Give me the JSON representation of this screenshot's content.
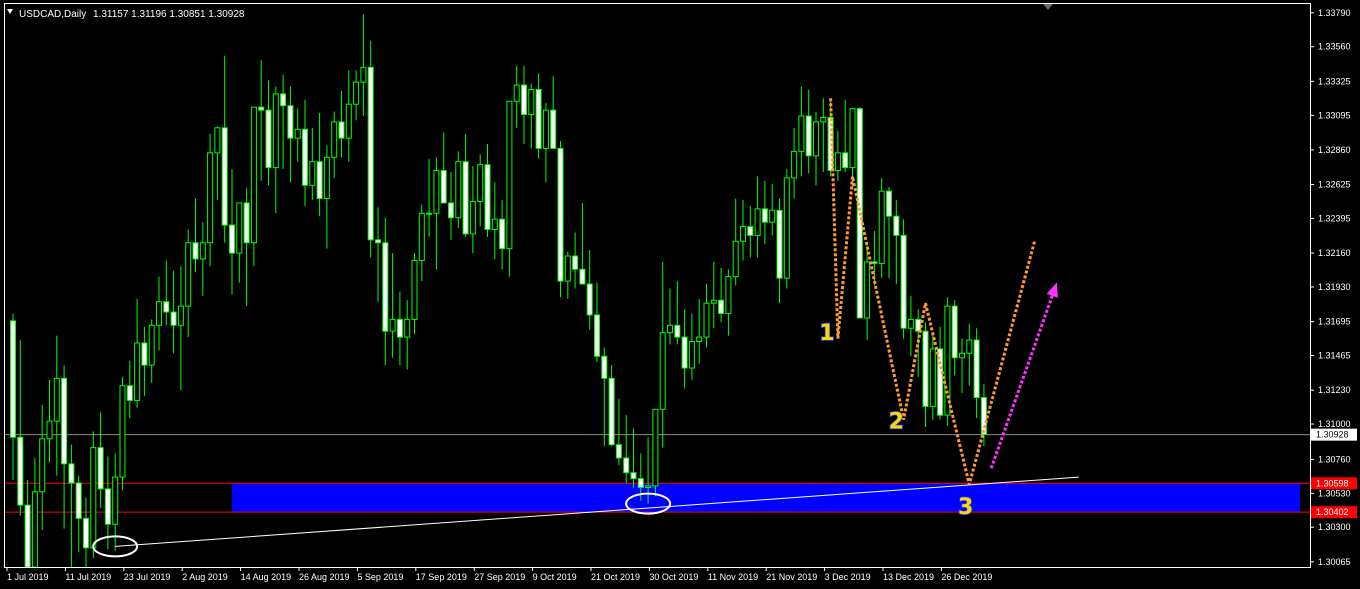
{
  "header": {
    "symbol": "USDCAD,Daily",
    "ohlc": "1.31157 1.31196 1.30851 1.30928"
  },
  "colors": {
    "background": "#000000",
    "candle": "#00ff00",
    "bull_body": "#000000",
    "bear_body": "#ffffff",
    "zone": "#0000ff",
    "zone_border": "#ff0000",
    "trendline": "#ffffff",
    "zigzag": "#ff9933",
    "arrow": "#ff33ff",
    "label_fill": "#ffd700",
    "label_stroke": "#1e3cff",
    "price_line": "#8c8c8c"
  },
  "chart_data": {
    "type": "candlestick",
    "ylim": [
      1.3003,
      1.3385
    ],
    "y_ticks": [
      "1.30065",
      "1.30300",
      "1.30530",
      "1.30760",
      "1.31000",
      "1.31230",
      "1.31465",
      "1.31695",
      "1.31930",
      "1.32160",
      "1.32395",
      "1.32625",
      "1.32860",
      "1.33095",
      "1.33325",
      "1.33560",
      "1.33790"
    ],
    "x_ticks": [
      {
        "label": "1 Jul 2019",
        "i": 0
      },
      {
        "label": "11 Jul 2019",
        "i": 8
      },
      {
        "label": "23 Jul 2019",
        "i": 16
      },
      {
        "label": "2 Aug 2019",
        "i": 24
      },
      {
        "label": "14 Aug 2019",
        "i": 32
      },
      {
        "label": "26 Aug 2019",
        "i": 40
      },
      {
        "label": "5 Sep 2019",
        "i": 48
      },
      {
        "label": "17 Sep 2019",
        "i": 56
      },
      {
        "label": "27 Sep 2019",
        "i": 64
      },
      {
        "label": "9 Oct 2019",
        "i": 72
      },
      {
        "label": "21 Oct 2019",
        "i": 80
      },
      {
        "label": "30 Oct 2019",
        "i": 88
      },
      {
        "label": "11 Nov 2019",
        "i": 96
      },
      {
        "label": "21 Nov 2019",
        "i": 104
      },
      {
        "label": "3 Dec 2019",
        "i": 112
      },
      {
        "label": "13 Dec 2019",
        "i": 120
      },
      {
        "label": "26 Dec 2019",
        "i": 128
      }
    ],
    "current_price": {
      "value": 1.30928,
      "label": "1.30928"
    },
    "support_zone": {
      "top": 1.30598,
      "bottom": 1.30402,
      "top_label": "1.30598",
      "bottom_label": "1.30402",
      "start_i": 30
    },
    "trendline": {
      "i1": 14,
      "p1": 1.3017,
      "i2": 146,
      "p2": 1.3064
    },
    "ellipses": [
      {
        "i": 14,
        "p": 1.3017
      },
      {
        "i": 87,
        "p": 1.3046
      }
    ],
    "zigzag": [
      {
        "i": 112,
        "p": 1.3321
      },
      {
        "i": 113,
        "p": 1.3158
      },
      {
        "i": 115,
        "p": 1.3268
      },
      {
        "i": 122,
        "p": 1.3103
      },
      {
        "i": 125,
        "p": 1.3182
      },
      {
        "i": 131,
        "p": 1.3059
      },
      {
        "i": 140,
        "p": 1.3225
      }
    ],
    "arrow": {
      "i1": 134,
      "p1": 1.307,
      "i2": 143,
      "p2": 1.3196
    },
    "labels": [
      {
        "text": "1",
        "i": 111.5,
        "p": 1.3157
      },
      {
        "text": "2",
        "i": 121,
        "p": 1.3097
      },
      {
        "text": "3",
        "i": 130.5,
        "p": 1.3039
      }
    ],
    "candles": [
      [
        1.317,
        1.3175,
        1.3062,
        1.3091
      ],
      [
        1.3091,
        1.3157,
        1.3038,
        1.3045
      ],
      [
        1.3045,
        1.3062,
        1.2978,
        1.3003
      ],
      [
        1.3003,
        1.3077,
        1.2991,
        1.3054
      ],
      [
        1.3054,
        1.3113,
        1.3028,
        1.309
      ],
      [
        1.309,
        1.313,
        1.3074,
        1.3102
      ],
      [
        1.3102,
        1.316,
        1.3065,
        1.3131
      ],
      [
        1.3131,
        1.314,
        1.3029,
        1.3073
      ],
      [
        1.3073,
        1.3086,
        1.2997,
        1.306
      ],
      [
        1.306,
        1.3065,
        1.3013,
        1.3036
      ],
      [
        1.3036,
        1.305,
        1.3003,
        1.3016
      ],
      [
        1.3016,
        1.3095,
        1.3009,
        1.3084
      ],
      [
        1.3084,
        1.3108,
        1.3043,
        1.3056
      ],
      [
        1.3056,
        1.3078,
        1.3015,
        1.3032
      ],
      [
        1.3032,
        1.308,
        1.3014,
        1.3064
      ],
      [
        1.3064,
        1.3132,
        1.3055,
        1.3126
      ],
      [
        1.3126,
        1.3143,
        1.3104,
        1.3116
      ],
      [
        1.3116,
        1.3185,
        1.3111,
        1.3155
      ],
      [
        1.3155,
        1.3166,
        1.3119,
        1.314
      ],
      [
        1.314,
        1.3171,
        1.3128,
        1.3167
      ],
      [
        1.3167,
        1.32,
        1.315,
        1.3183
      ],
      [
        1.3183,
        1.3211,
        1.3167,
        1.3176
      ],
      [
        1.3176,
        1.3204,
        1.3148,
        1.3167
      ],
      [
        1.3167,
        1.3207,
        1.3123,
        1.318
      ],
      [
        1.318,
        1.3232,
        1.3159,
        1.3223
      ],
      [
        1.3223,
        1.3253,
        1.3203,
        1.3212
      ],
      [
        1.3212,
        1.3237,
        1.3187,
        1.3223
      ],
      [
        1.3223,
        1.3297,
        1.3207,
        1.3284
      ],
      [
        1.3284,
        1.3302,
        1.3252,
        1.3301
      ],
      [
        1.3301,
        1.335,
        1.3223,
        1.3235
      ],
      [
        1.3235,
        1.3273,
        1.3188,
        1.3216
      ],
      [
        1.3216,
        1.3238,
        1.3196,
        1.325
      ],
      [
        1.325,
        1.326,
        1.318,
        1.3223
      ],
      [
        1.3223,
        1.3265,
        1.3207,
        1.3315
      ],
      [
        1.3315,
        1.3347,
        1.3265,
        1.3313
      ],
      [
        1.3313,
        1.3333,
        1.3262,
        1.3274
      ],
      [
        1.3274,
        1.3329,
        1.3243,
        1.3324
      ],
      [
        1.3324,
        1.3337,
        1.3273,
        1.3316
      ],
      [
        1.3316,
        1.3329,
        1.3264,
        1.3294
      ],
      [
        1.3294,
        1.3314,
        1.3278,
        1.33
      ],
      [
        1.33,
        1.332,
        1.3248,
        1.3262
      ],
      [
        1.3262,
        1.3301,
        1.3252,
        1.3278
      ],
      [
        1.3278,
        1.3311,
        1.3241,
        1.3253
      ],
      [
        1.3253,
        1.3289,
        1.3219,
        1.3281
      ],
      [
        1.3281,
        1.3312,
        1.3267,
        1.3305
      ],
      [
        1.3305,
        1.3326,
        1.3281,
        1.3294
      ],
      [
        1.3294,
        1.334,
        1.3278,
        1.3317
      ],
      [
        1.3317,
        1.334,
        1.3306,
        1.3332
      ],
      [
        1.3332,
        1.3378,
        1.3309,
        1.3342
      ],
      [
        1.3342,
        1.336,
        1.3213,
        1.3225
      ],
      [
        1.3225,
        1.3247,
        1.3183,
        1.3223
      ],
      [
        1.3223,
        1.324,
        1.314,
        1.3163
      ],
      [
        1.3163,
        1.3216,
        1.3145,
        1.3171
      ],
      [
        1.3171,
        1.319,
        1.314,
        1.3159
      ],
      [
        1.3159,
        1.3184,
        1.3137,
        1.3171
      ],
      [
        1.3171,
        1.3216,
        1.3161,
        1.3211
      ],
      [
        1.3211,
        1.3249,
        1.3197,
        1.3243
      ],
      [
        1.3243,
        1.328,
        1.3227,
        1.3243
      ],
      [
        1.3243,
        1.3281,
        1.3205,
        1.3272
      ],
      [
        1.3272,
        1.3298,
        1.3252,
        1.325
      ],
      [
        1.325,
        1.3271,
        1.3225,
        1.324
      ],
      [
        1.324,
        1.3285,
        1.3233,
        1.3278
      ],
      [
        1.3278,
        1.3297,
        1.3227,
        1.3229
      ],
      [
        1.3229,
        1.3275,
        1.3216,
        1.3251
      ],
      [
        1.3251,
        1.3283,
        1.3234,
        1.3276
      ],
      [
        1.3276,
        1.329,
        1.3227,
        1.3232
      ],
      [
        1.3232,
        1.3264,
        1.3212,
        1.3239
      ],
      [
        1.3239,
        1.3252,
        1.3205,
        1.3219
      ],
      [
        1.3219,
        1.328,
        1.32,
        1.3319
      ],
      [
        1.3319,
        1.3343,
        1.3301,
        1.333
      ],
      [
        1.333,
        1.3343,
        1.329,
        1.331
      ],
      [
        1.331,
        1.3331,
        1.3287,
        1.3327
      ],
      [
        1.3327,
        1.3338,
        1.328,
        1.3287
      ],
      [
        1.3287,
        1.3318,
        1.3264,
        1.3313
      ],
      [
        1.3313,
        1.3336,
        1.329,
        1.3287
      ],
      [
        1.3287,
        1.3292,
        1.3186,
        1.3197
      ],
      [
        1.3197,
        1.3217,
        1.3185,
        1.3214
      ],
      [
        1.3214,
        1.323,
        1.3192,
        1.3205
      ],
      [
        1.3205,
        1.325,
        1.3197,
        1.3195
      ],
      [
        1.3195,
        1.3218,
        1.3164,
        1.3174
      ],
      [
        1.3174,
        1.3196,
        1.3142,
        1.3146
      ],
      [
        1.3146,
        1.3152,
        1.3085,
        1.3131
      ],
      [
        1.3131,
        1.314,
        1.3085,
        1.3086
      ],
      [
        1.3086,
        1.3117,
        1.3072,
        1.3077
      ],
      [
        1.3077,
        1.3106,
        1.306,
        1.3067
      ],
      [
        1.3067,
        1.3097,
        1.3057,
        1.3063
      ],
      [
        1.3063,
        1.308,
        1.3048,
        1.3057
      ],
      [
        1.3057,
        1.3091,
        1.3046,
        1.3058
      ],
      [
        1.3058,
        1.3109,
        1.3051,
        1.311
      ],
      [
        1.311,
        1.321,
        1.3084,
        1.3162
      ],
      [
        1.3162,
        1.3192,
        1.3154,
        1.3167
      ],
      [
        1.3167,
        1.3197,
        1.3154,
        1.3159
      ],
      [
        1.3159,
        1.3178,
        1.3124,
        1.3138
      ],
      [
        1.3138,
        1.3175,
        1.313,
        1.3156
      ],
      [
        1.3156,
        1.3185,
        1.3141,
        1.3159
      ],
      [
        1.3159,
        1.3195,
        1.3152,
        1.3182
      ],
      [
        1.3182,
        1.321,
        1.3165,
        1.3184
      ],
      [
        1.3184,
        1.3206,
        1.3169,
        1.3175
      ],
      [
        1.3175,
        1.3205,
        1.316,
        1.32
      ],
      [
        1.32,
        1.3253,
        1.3194,
        1.3224
      ],
      [
        1.3224,
        1.3252,
        1.3211,
        1.3234
      ],
      [
        1.3234,
        1.3248,
        1.3213,
        1.3228
      ],
      [
        1.3228,
        1.3268,
        1.3213,
        1.3246
      ],
      [
        1.3246,
        1.3265,
        1.3222,
        1.3237
      ],
      [
        1.3237,
        1.3263,
        1.3228,
        1.3245
      ],
      [
        1.3245,
        1.3253,
        1.3182,
        1.3199
      ],
      [
        1.3199,
        1.3273,
        1.3192,
        1.3267
      ],
      [
        1.3267,
        1.3301,
        1.3253,
        1.3285
      ],
      [
        1.3285,
        1.3329,
        1.3268,
        1.3309
      ],
      [
        1.3309,
        1.3327,
        1.327,
        1.3282
      ],
      [
        1.3282,
        1.3312,
        1.3262,
        1.3305
      ],
      [
        1.3305,
        1.3321,
        1.3271,
        1.3308
      ],
      [
        1.3308,
        1.3319,
        1.3268,
        1.3272
      ],
      [
        1.3272,
        1.3299,
        1.3265,
        1.3284
      ],
      [
        1.3284,
        1.332,
        1.3271,
        1.3274
      ],
      [
        1.3274,
        1.3313,
        1.326,
        1.3314
      ],
      [
        1.3314,
        1.3315,
        1.3172,
        1.3172
      ],
      [
        1.3172,
        1.3222,
        1.3157,
        1.321
      ],
      [
        1.321,
        1.3231,
        1.3194,
        1.3209
      ],
      [
        1.3209,
        1.3267,
        1.3199,
        1.3258
      ],
      [
        1.3258,
        1.3261,
        1.3199,
        1.3241
      ],
      [
        1.3241,
        1.3252,
        1.3195,
        1.3228
      ],
      [
        1.3228,
        1.3239,
        1.3158,
        1.3165
      ],
      [
        1.3165,
        1.3187,
        1.3146,
        1.3171
      ],
      [
        1.3171,
        1.3178,
        1.3132,
        1.3163
      ],
      [
        1.3163,
        1.3169,
        1.3098,
        1.3112
      ],
      [
        1.3112,
        1.3161,
        1.3103,
        1.3151
      ],
      [
        1.3151,
        1.3166,
        1.3103,
        1.3106
      ],
      [
        1.3106,
        1.3186,
        1.3099,
        1.318
      ],
      [
        1.318,
        1.3184,
        1.3133,
        1.3145
      ],
      [
        1.3145,
        1.3158,
        1.3121,
        1.3148
      ],
      [
        1.3148,
        1.3168,
        1.3126,
        1.3157
      ],
      [
        1.3157,
        1.3165,
        1.3104,
        1.3118
      ],
      [
        1.3118,
        1.3127,
        1.3085,
        1.3093
      ]
    ]
  }
}
